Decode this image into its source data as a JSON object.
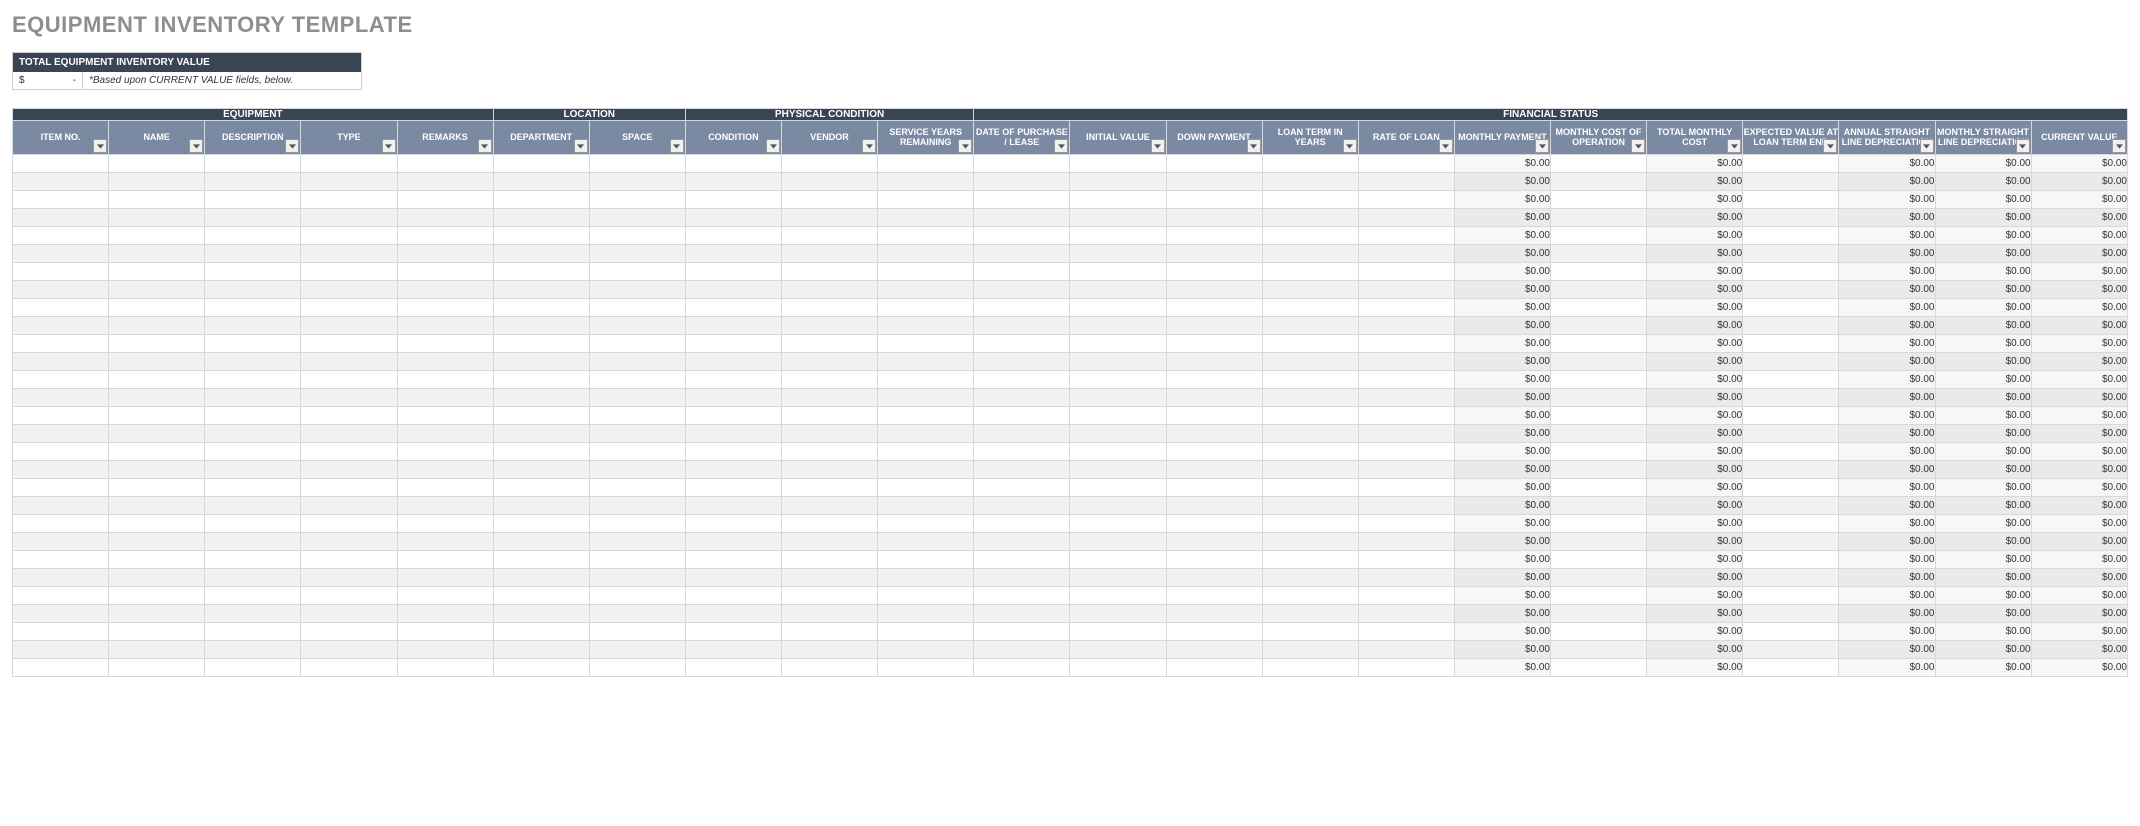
{
  "title": "EQUIPMENT INVENTORY TEMPLATE",
  "summary": {
    "heading": "TOTAL EQUIPMENT INVENTORY VALUE",
    "currency_symbol": "$",
    "value": "-",
    "note": "*Based upon CURRENT VALUE fields, below."
  },
  "groups": [
    {
      "label": "EQUIPMENT",
      "span": 5
    },
    {
      "label": "LOCATION",
      "span": 2
    },
    {
      "label": "PHYSICAL CONDITION",
      "span": 3
    },
    {
      "label": "FINANCIAL STATUS",
      "span": 12
    }
  ],
  "columns": [
    {
      "label": "ITEM NO.",
      "calc": false,
      "w": "w-sm"
    },
    {
      "label": "NAME",
      "calc": false,
      "w": "w-md"
    },
    {
      "label": "DESCRIPTION",
      "calc": false,
      "w": "w-lg"
    },
    {
      "label": "TYPE",
      "calc": false,
      "w": "w-md"
    },
    {
      "label": "REMARKS",
      "calc": false,
      "w": "w-lg"
    },
    {
      "label": "DEPARTMENT",
      "calc": false,
      "w": "w-md"
    },
    {
      "label": "SPACE",
      "calc": false,
      "w": "w-md"
    },
    {
      "label": "CONDITION",
      "calc": false,
      "w": "w-md"
    },
    {
      "label": "VENDOR",
      "calc": false,
      "w": "w-md"
    },
    {
      "label": "SERVICE YEARS REMAINING",
      "calc": false,
      "w": "w-xl"
    },
    {
      "label": "DATE OF PURCHASE / LEASE",
      "calc": false,
      "w": "w-md"
    },
    {
      "label": "INITIAL VALUE",
      "calc": false,
      "w": "w-md"
    },
    {
      "label": "DOWN PAYMENT",
      "calc": false,
      "w": "w-md"
    },
    {
      "label": "LOAN TERM IN YEARS",
      "calc": false,
      "w": "w-md"
    },
    {
      "label": "RATE OF LOAN",
      "calc": false,
      "w": "w-md"
    },
    {
      "label": "MONTHLY PAYMENT",
      "calc": true,
      "w": "w-md"
    },
    {
      "label": "MONTHLY COST OF OPERATION",
      "calc": false,
      "w": "w-xl"
    },
    {
      "label": "TOTAL MONTHLY COST",
      "calc": true,
      "w": "w-md"
    },
    {
      "label": "EXPECTED VALUE AT LOAN TERM END",
      "calc": false,
      "w": "w-xl"
    },
    {
      "label": "ANNUAL STRAIGHT LINE DEPRECIATION",
      "calc": true,
      "w": "w-xl"
    },
    {
      "label": "MONTHLY STRAIGHT LINE DEPRECIATION",
      "calc": true,
      "w": "w-xl"
    },
    {
      "label": "CURRENT VALUE",
      "calc": true,
      "w": "w-md"
    }
  ],
  "zero_display": "$0.00",
  "row_count": 29
}
